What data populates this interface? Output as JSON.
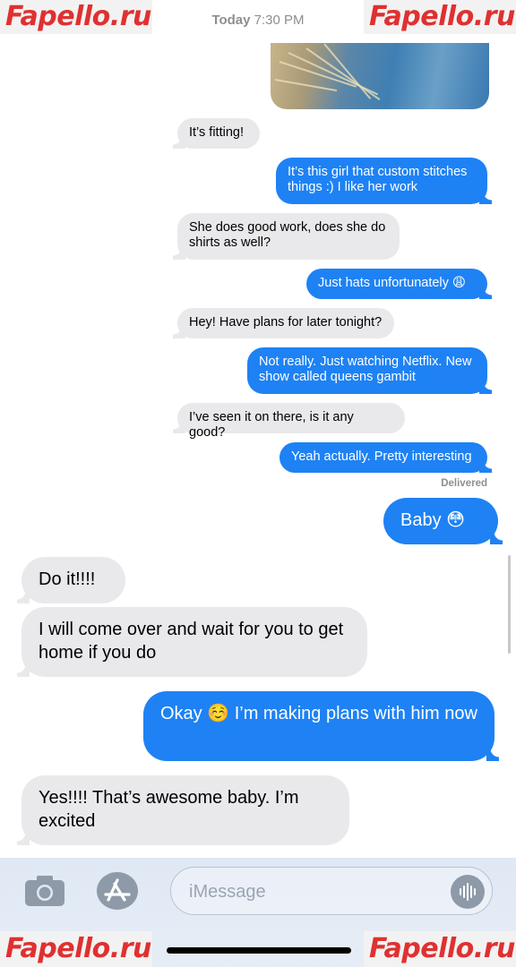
{
  "watermark": "Fapello.ru",
  "header": {
    "timestamp_day": "Today",
    "timestamp_time": "7:30 PM"
  },
  "messages": [
    {
      "dir": "in",
      "text": "It’s fitting!"
    },
    {
      "dir": "out",
      "text": "It’s this girl that custom stitches things :) I like her work"
    },
    {
      "dir": "in",
      "text": "She does good work, does she do shirts as well?"
    },
    {
      "dir": "out",
      "text": "Just hats unfortunately 😩"
    },
    {
      "dir": "in",
      "text": "Hey! Have plans for later tonight?"
    },
    {
      "dir": "out",
      "text": "Not really. Just watching Netflix. New show called queens gambit"
    },
    {
      "dir": "in",
      "text": "I’ve seen it on there, is it any good?"
    },
    {
      "dir": "out",
      "text": "Yeah actually. Pretty interesting"
    },
    {
      "dir": "out",
      "text": "Baby 😳"
    },
    {
      "dir": "in",
      "text": "Do it!!!!"
    },
    {
      "dir": "in",
      "text": "I will come over and wait for you to get home if you do"
    },
    {
      "dir": "out",
      "text": "Okay ☺️ I’m making plans with him now"
    },
    {
      "dir": "in",
      "text": "Yes!!!! That’s awesome baby. I’m excited"
    }
  ],
  "status": {
    "delivered": "Delivered"
  },
  "composer": {
    "placeholder": "iMessage",
    "camera_icon": "camera-icon",
    "apps_icon": "app-store-icon",
    "audio_icon": "audio-waveform-icon"
  },
  "colors": {
    "outgoing": "#1e82f4",
    "incoming": "#e9e9eb",
    "watermark": "#e03030"
  }
}
